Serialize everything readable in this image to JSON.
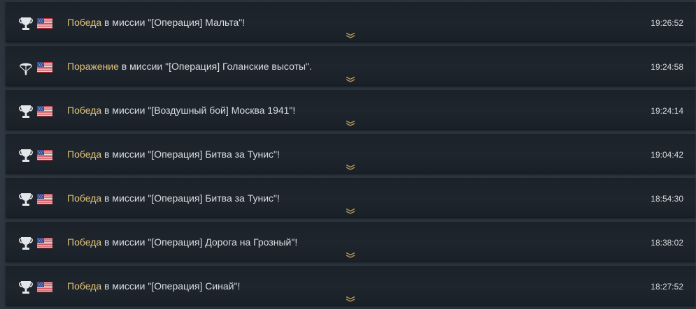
{
  "labels": {
    "mission_prefix": "в миссии",
    "victory": "Победа",
    "defeat": "Поражение"
  },
  "colors": {
    "result_text": "#e6c47a",
    "body_text": "#d9dde2",
    "row_background": "#1d242b"
  },
  "entries": [
    {
      "result": "Победа",
      "icon": "trophy-icon",
      "country": "usa-flag-icon",
      "text": "в миссии \"[Операция] Мальта\"!",
      "time": "19:26:52"
    },
    {
      "result": "Поражение",
      "icon": "parachute-icon",
      "country": "usa-flag-icon",
      "text": "в миссии \"[Операция] Голанские высоты\".",
      "time": "19:24:58"
    },
    {
      "result": "Победа",
      "icon": "trophy-icon",
      "country": "usa-flag-icon",
      "text": "в миссии \"[Воздушный бой] Москва 1941\"!",
      "time": "19:24:14"
    },
    {
      "result": "Победа",
      "icon": "trophy-icon",
      "country": "usa-flag-icon",
      "text": "в миссии \"[Операция] Битва за Тунис\"!",
      "time": "19:04:42"
    },
    {
      "result": "Победа",
      "icon": "trophy-icon",
      "country": "usa-flag-icon",
      "text": "в миссии \"[Операция] Битва за Тунис\"!",
      "time": "18:54:30"
    },
    {
      "result": "Победа",
      "icon": "trophy-icon",
      "country": "usa-flag-icon",
      "text": "в миссии \"[Операция] Дорога на Грозный\"!",
      "time": "18:38:02"
    },
    {
      "result": "Победа",
      "icon": "trophy-icon",
      "country": "usa-flag-icon",
      "text": "в миссии \"[Операция] Синай\"!",
      "time": "18:27:52"
    }
  ]
}
